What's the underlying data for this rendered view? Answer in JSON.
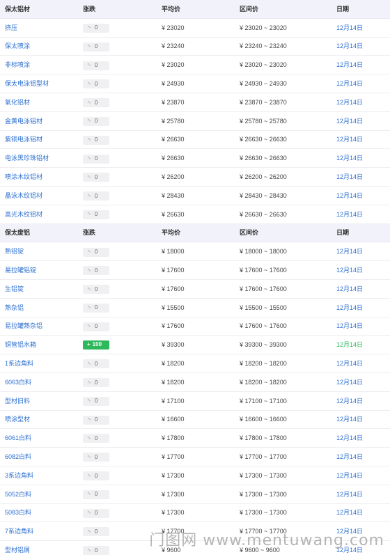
{
  "sections": [
    {
      "header": {
        "name": "保太铝材",
        "change": "涨跌",
        "avg": "平均价",
        "range": "区间价",
        "date": "日期"
      },
      "rows": [
        {
          "name": "挤压",
          "change": "0",
          "avg": "¥ 23020",
          "range": "¥ 23020 ~ 23020",
          "date": "12月14日"
        },
        {
          "name": "保太喷涂",
          "change": "0",
          "avg": "¥ 23240",
          "range": "¥ 23240 ~ 23240",
          "date": "12月14日"
        },
        {
          "name": "非标喷涂",
          "change": "0",
          "avg": "¥ 23020",
          "range": "¥ 23020 ~ 23020",
          "date": "12月14日"
        },
        {
          "name": "保太电泳铝型材",
          "change": "0",
          "avg": "¥ 24930",
          "range": "¥ 24930 ~ 24930",
          "date": "12月14日"
        },
        {
          "name": "氧化铝材",
          "change": "0",
          "avg": "¥ 23870",
          "range": "¥ 23870 ~ 23870",
          "date": "12月14日"
        },
        {
          "name": "金黄电泳铝材",
          "change": "0",
          "avg": "¥ 25780",
          "range": "¥ 25780 ~ 25780",
          "date": "12月14日"
        },
        {
          "name": "紫铜电泳铝材",
          "change": "0",
          "avg": "¥ 26630",
          "range": "¥ 26630 ~ 26630",
          "date": "12月14日"
        },
        {
          "name": "电泳黑珍珠铝材",
          "change": "0",
          "avg": "¥ 26630",
          "range": "¥ 26630 ~ 26630",
          "date": "12月14日"
        },
        {
          "name": "喷涂木纹铝材",
          "change": "0",
          "avg": "¥ 26200",
          "range": "¥ 26200 ~ 26200",
          "date": "12月14日"
        },
        {
          "name": "晶泳木纹铝材",
          "change": "0",
          "avg": "¥ 28430",
          "range": "¥ 28430 ~ 28430",
          "date": "12月14日"
        },
        {
          "name": "高光木纹铝材",
          "change": "0",
          "avg": "¥ 26630",
          "range": "¥ 26630 ~ 26630",
          "date": "12月14日"
        }
      ]
    },
    {
      "header": {
        "name": "保太废铝",
        "change": "涨跌",
        "avg": "平均价",
        "range": "区间价",
        "date": "日期"
      },
      "rows": [
        {
          "name": "熟铝锭",
          "change": "0",
          "avg": "¥ 18000",
          "range": "¥ 18000 ~ 18000",
          "date": "12月14日"
        },
        {
          "name": "易拉罐铝锭",
          "change": "0",
          "avg": "¥ 17600",
          "range": "¥ 17600 ~ 17600",
          "date": "12月14日"
        },
        {
          "name": "生铝锭",
          "change": "0",
          "avg": "¥ 17600",
          "range": "¥ 17600 ~ 17600",
          "date": "12月14日"
        },
        {
          "name": "熟杂铝",
          "change": "0",
          "avg": "¥ 15500",
          "range": "¥ 15500 ~ 15500",
          "date": "12月14日"
        },
        {
          "name": "易拉罐熟杂铝",
          "change": "0",
          "avg": "¥ 17600",
          "range": "¥ 17600 ~ 17600",
          "date": "12月14日"
        },
        {
          "name": "铜管铝水箱",
          "change": "100",
          "up": true,
          "avg": "¥ 39300",
          "range": "¥ 39300 ~ 39300",
          "date": "12月14日"
        },
        {
          "name": "1系边角料",
          "change": "0",
          "avg": "¥ 18200",
          "range": "¥ 18200 ~ 18200",
          "date": "12月14日"
        },
        {
          "name": "6063白料",
          "change": "0",
          "avg": "¥ 18200",
          "range": "¥ 18200 ~ 18200",
          "date": "12月14日"
        },
        {
          "name": "型材旧料",
          "change": "0",
          "avg": "¥ 17100",
          "range": "¥ 17100 ~ 17100",
          "date": "12月14日"
        },
        {
          "name": "喷涂型材",
          "change": "0",
          "avg": "¥ 16600",
          "range": "¥ 16600 ~ 16600",
          "date": "12月14日"
        },
        {
          "name": "6061白料",
          "change": "0",
          "avg": "¥ 17800",
          "range": "¥ 17800 ~ 17800",
          "date": "12月14日"
        },
        {
          "name": "6082白料",
          "change": "0",
          "avg": "¥ 17700",
          "range": "¥ 17700 ~ 17700",
          "date": "12月14日"
        },
        {
          "name": "3系边角料",
          "change": "0",
          "avg": "¥ 17300",
          "range": "¥ 17300 ~ 17300",
          "date": "12月14日"
        },
        {
          "name": "5052白料",
          "change": "0",
          "avg": "¥ 17300",
          "range": "¥ 17300 ~ 17300",
          "date": "12月14日"
        },
        {
          "name": "5083白料",
          "change": "0",
          "avg": "¥ 17300",
          "range": "¥ 17300 ~ 17300",
          "date": "12月14日"
        },
        {
          "name": "7系边角料",
          "change": "0",
          "avg": "¥ 17700",
          "range": "¥ 17700 ~ 17700",
          "date": "12月14日"
        },
        {
          "name": "型材铝屑",
          "change": "0",
          "avg": "¥ 9600",
          "range": "¥ 9600 ~ 9600",
          "date": "12月14日"
        }
      ]
    }
  ],
  "watermark": "门图网 www.mentuwang.com",
  "icons": {
    "flat": "flat-trend-icon",
    "up": "up-arrow-icon"
  },
  "colors": {
    "link": "#2c6fd1",
    "up": "#2eb85c",
    "header_bg": "#f2f2fb"
  }
}
